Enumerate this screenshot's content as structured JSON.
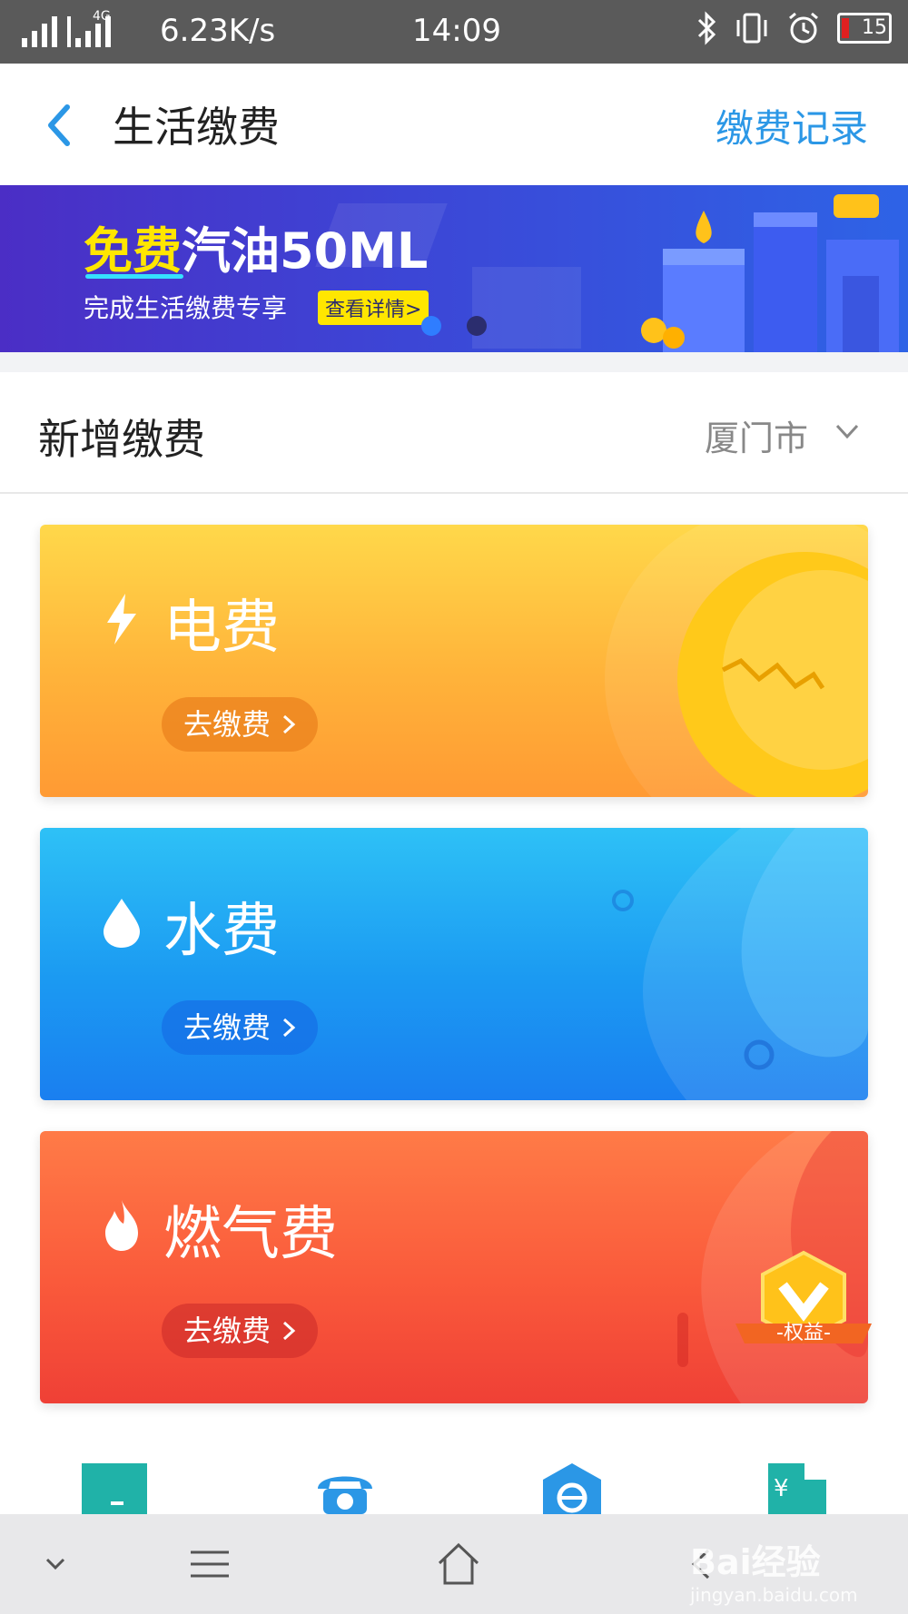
{
  "status_bar": {
    "net_type": "4G",
    "speed": "6.23K/s",
    "time": "14:09",
    "battery": "15"
  },
  "header": {
    "title": "生活缴费",
    "records_label": "缴费记录"
  },
  "banner": {
    "headline_highlight": "免费",
    "headline_rest": "汽油50ML",
    "subtitle": "完成生活缴费专享",
    "detail_button": "查看详情>"
  },
  "section": {
    "title": "新增缴费",
    "city": "厦门市"
  },
  "cards": [
    {
      "name": "电费",
      "pay_label": "去缴费",
      "icon": "lightning-icon"
    },
    {
      "name": "水费",
      "pay_label": "去缴费",
      "icon": "water-drop-icon"
    },
    {
      "name": "燃气费",
      "pay_label": "去缴费",
      "icon": "flame-icon"
    }
  ],
  "badge": {
    "label": "-权益-"
  },
  "quick_icons": [
    "tv-icon",
    "phone-icon",
    "broadband-icon",
    "property-fee-icon"
  ],
  "watermark": {
    "brand": "Bai经验",
    "url": "jingyan.baidu.com"
  },
  "colors": {
    "accent": "#2b97e6",
    "electric": "#ffb33a",
    "water": "#1b9af2",
    "gas": "#fa5a3b"
  }
}
